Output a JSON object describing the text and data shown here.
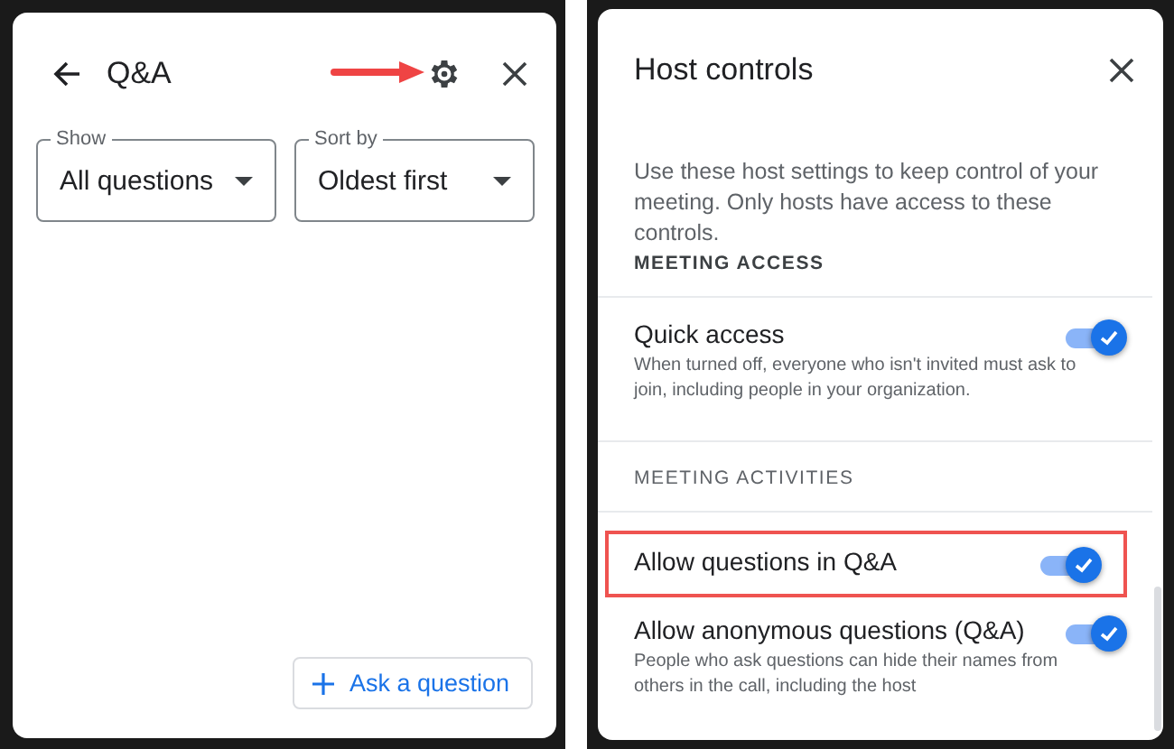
{
  "qa_panel": {
    "title": "Q&A",
    "filters": [
      {
        "label": "Show",
        "value": "All questions"
      },
      {
        "label": "Sort by",
        "value": "Oldest first"
      }
    ],
    "ask_button": "Ask a question"
  },
  "host_controls": {
    "title": "Host controls",
    "description": "Use these host settings to keep control of your meeting. Only hosts have access to these controls.",
    "sections": [
      {
        "heading": "MEETING ACCESS",
        "settings": [
          {
            "label": "Quick access",
            "description": "When turned off, everyone who isn't invited must ask to join, including people in your organization.",
            "on": true,
            "highlighted": false
          }
        ]
      },
      {
        "heading": "MEETING ACTIVITIES",
        "settings": [
          {
            "label": "Allow questions in Q&A",
            "on": true,
            "highlighted": true
          },
          {
            "label": "Allow anonymous questions (Q&A)",
            "description": "People who ask questions can hide their names from others in the call, including the host",
            "on": true,
            "highlighted": false
          }
        ]
      }
    ]
  }
}
